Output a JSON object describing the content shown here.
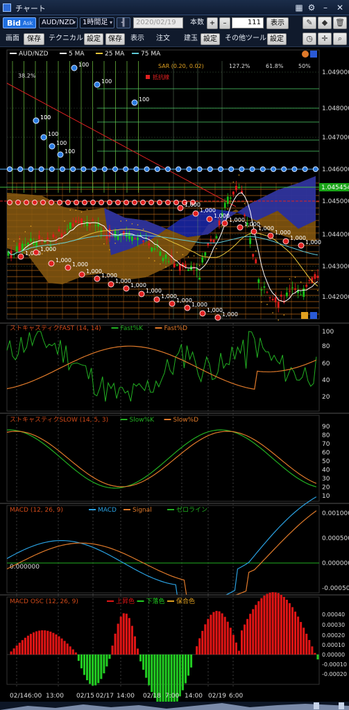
{
  "window": {
    "title": "チャート"
  },
  "toolbar": {
    "bid_label": "Bid",
    "ask_label": "Ask",
    "pair": "AUD/NZD",
    "timeframe": "1時間足",
    "date": "2020/02/19",
    "count_label": "本数",
    "count_value": "111",
    "show_label": "表示",
    "screen_label": "画面",
    "save_label": "保存",
    "technical_label": "テクニカル",
    "settings_label": "設定",
    "display_label": "表示",
    "order_label": "注文",
    "position_label": "建玉",
    "other_tools_label": "その他ツール"
  },
  "legend": {
    "main": [
      "AUD/NZD",
      "5 MA",
      "25 MA",
      "75 MA"
    ],
    "main_colors": [
      "#ffffff",
      "#ffffff",
      "#e6c43a",
      "#5fc9d6"
    ],
    "sar": "SAR (0.20, 0.02)",
    "fib": [
      "127.2%",
      "61.8%",
      "50%",
      "38.2%"
    ],
    "breakout": "抵抗線"
  },
  "price_axis": {
    "labels": [
      "1.049000",
      "1.048000",
      "1.047000",
      "1.046000",
      "1.045000",
      "1.044000",
      "1.043000",
      "1.042000"
    ],
    "current_price": "1.045454",
    "current_color": "#19a317"
  },
  "order_labels": {
    "buy": [
      "100",
      "100",
      "100",
      "100",
      "100",
      "100",
      "100",
      "100"
    ],
    "sell": [
      "1,000",
      "1,000",
      "1,000",
      "1,000",
      "1,000",
      "1,000",
      "1,000",
      "1,000",
      "1,000",
      "1,000",
      "1,000",
      "1,000",
      "1,000",
      "1,000",
      "1,000",
      "1,000",
      "1,000",
      "1,000",
      "1,000",
      "1,000",
      "1,000",
      "1,000",
      "1,000"
    ]
  },
  "stoch_fast": {
    "title": "ストキャスティクFAST (14, 14)",
    "k_label": "Fast%K",
    "d_label": "Fast%D",
    "k_color": "#22b022",
    "d_color": "#e07a2a",
    "axis": [
      "100",
      "80",
      "60",
      "40",
      "20"
    ]
  },
  "stoch_slow": {
    "title": "ストキャスティクSLOW (14, 5, 3)",
    "k_label": "Slow%K",
    "d_label": "Slow%D",
    "k_color": "#22b022",
    "d_color": "#e07a2a",
    "axis": [
      "90",
      "80",
      "70",
      "60",
      "50",
      "40",
      "30",
      "20",
      "10"
    ]
  },
  "macd": {
    "title": "MACD (12, 26, 9)",
    "macd_label": "MACD",
    "signal_label": "Signal",
    "zero_label": "ゼロライン",
    "macd_color": "#2aa0e0",
    "signal_color": "#e07a2a",
    "zero_color": "#22b022",
    "zero_value_label": "0.000000",
    "axis": [
      "0.001000",
      "0.000500",
      "0.000000",
      "-0.000500"
    ]
  },
  "macd_osc": {
    "title": "MACD OSC (12, 26, 9)",
    "up_label": "上昇色",
    "down_label": "下落色",
    "hold_label": "保合色",
    "up_color": "#e01515",
    "down_color": "#22cc22",
    "hold_color": "#e0a020",
    "axis": [
      "0.00040",
      "0.00030",
      "0.00020",
      "0.00010",
      "0.00000",
      "-0.00010",
      "-0.00020"
    ]
  },
  "time_axis": [
    "02/14",
    "6:00",
    "13:00",
    "02/15",
    "02/17",
    "14:00",
    "02/18",
    "7:00",
    "14:00",
    "02/19",
    "6:00"
  ]
}
